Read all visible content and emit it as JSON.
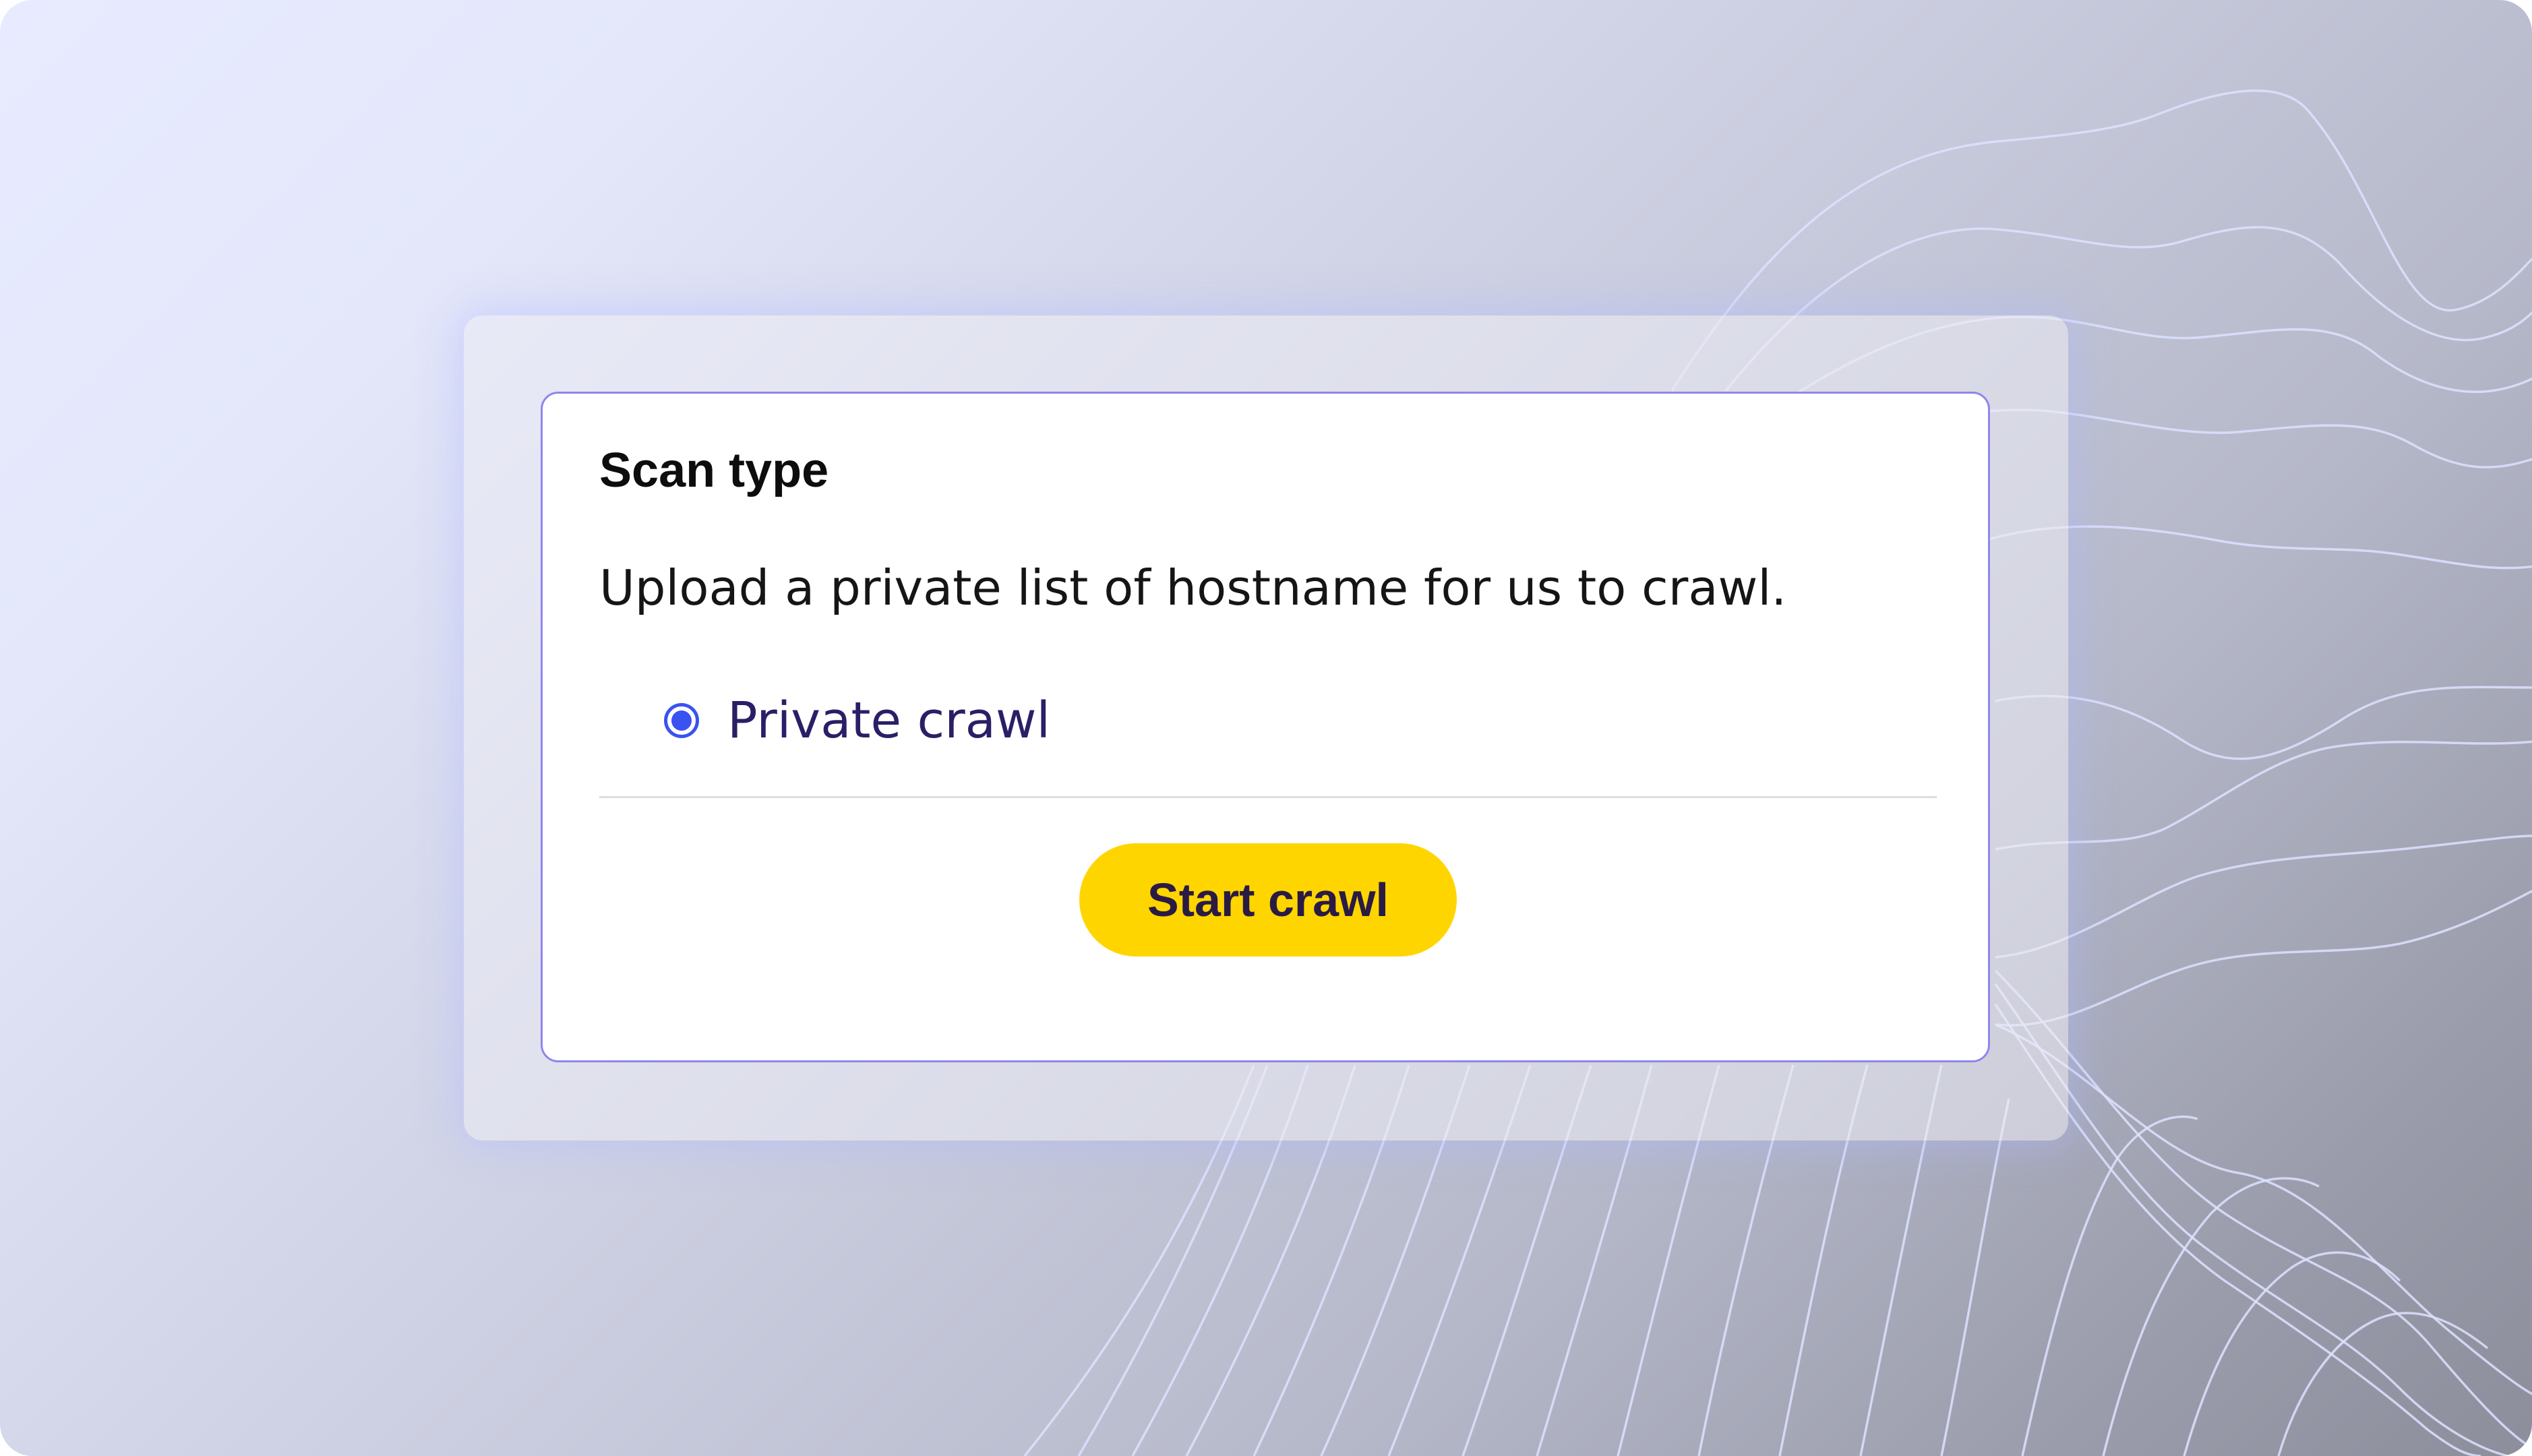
{
  "panel": {
    "title": "Scan type",
    "description": "Upload a private list of hostname for us to crawl.",
    "options": [
      {
        "label": "Private crawl",
        "selected": true
      }
    ],
    "start_button_label": "Start crawl"
  },
  "colors": {
    "accent": "#3a52f0",
    "card_border": "#8f86ec",
    "button": "#ffd500",
    "button_text": "#2a1b45",
    "option_text": "#2a1f66"
  },
  "icons": {
    "radio": "radio-selected-icon"
  }
}
